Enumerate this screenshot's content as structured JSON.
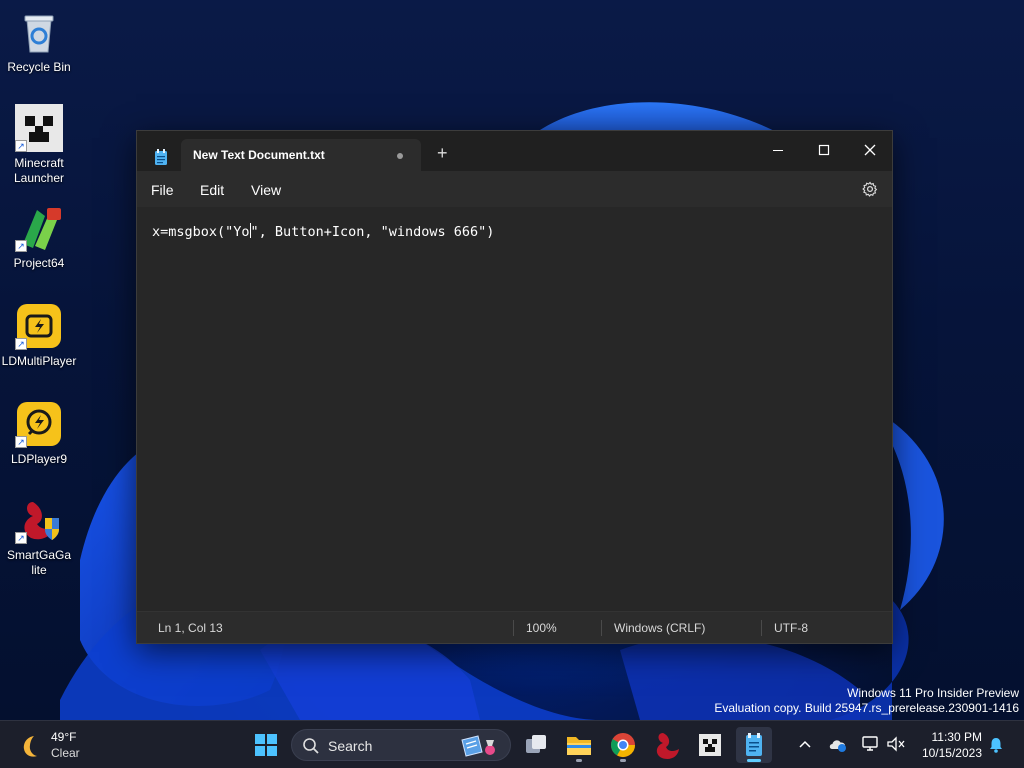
{
  "desktop": {
    "icons": [
      {
        "label": "Recycle Bin"
      },
      {
        "label": "Minecraft Launcher"
      },
      {
        "label": "Project64"
      },
      {
        "label": "LDMultiPlayer"
      },
      {
        "label": "LDPlayer9"
      },
      {
        "label": "SmartGaGa lite"
      }
    ],
    "watermark": {
      "line1": "Windows 11 Pro Insider Preview",
      "line2": "Evaluation copy. Build 25947.rs_prerelease.230901-1416"
    }
  },
  "notepad": {
    "tab_title": "New Text Document.txt",
    "new_tab_symbol": "+",
    "menu": [
      "File",
      "Edit",
      "View"
    ],
    "content_before_caret": "x=msgbox(\"Yo",
    "content_after_caret": "\", Button+Icon, \"windows 666\")",
    "status": {
      "position": "Ln 1, Col 13",
      "zoom": "100%",
      "line_ending": "Windows (CRLF)",
      "encoding": "UTF-8"
    }
  },
  "taskbar": {
    "weather": {
      "temp": "49°F",
      "condition": "Clear"
    },
    "search_label": "Search",
    "clock": {
      "time": "11:30 PM",
      "date": "10/15/2023"
    }
  }
}
